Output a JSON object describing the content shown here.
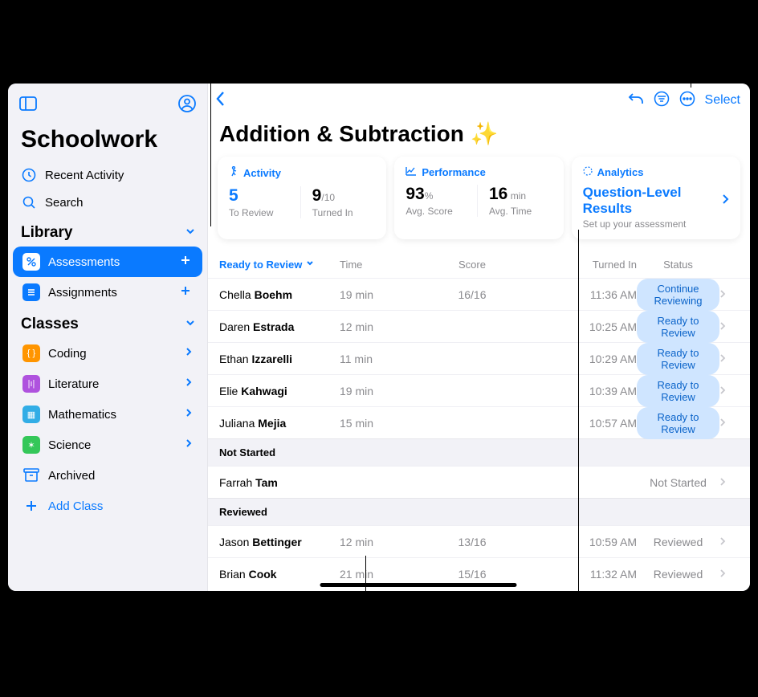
{
  "app": {
    "title": "Schoolwork"
  },
  "sidebar": {
    "recent_label": "Recent Activity",
    "search_label": "Search",
    "library_header": "Library",
    "lib_items": [
      {
        "label": "Assessments",
        "icon": "percent-icon",
        "color": "#0a7aff",
        "trailing": "plus",
        "active": true
      },
      {
        "label": "Assignments",
        "icon": "list-icon",
        "color": "#0a7aff",
        "trailing": "plus",
        "active": false
      }
    ],
    "classes_header": "Classes",
    "class_items": [
      {
        "label": "Coding",
        "color": "#ff9500"
      },
      {
        "label": "Literature",
        "color": "#af52de"
      },
      {
        "label": "Mathematics",
        "color": "#32ade6"
      },
      {
        "label": "Science",
        "color": "#34c759"
      }
    ],
    "archived_label": "Archived",
    "add_class_label": "Add Class"
  },
  "toolbar": {
    "select_label": "Select"
  },
  "page": {
    "title": "Addition & Subtraction ✨"
  },
  "cards": {
    "activity": {
      "head": "Activity",
      "m1_big": "5",
      "m1_sub": "To Review",
      "m2_big": "9",
      "m2_den": "/10",
      "m2_sub": "Turned In"
    },
    "performance": {
      "head": "Performance",
      "m1_big": "93",
      "m1_unit": "%",
      "m1_sub": "Avg. Score",
      "m2_big": "16",
      "m2_unit": " min",
      "m2_sub": "Avg. Time"
    },
    "analytics": {
      "head": "Analytics",
      "title": "Question-Level Results",
      "sub": "Set up your assessment"
    }
  },
  "table": {
    "cols": {
      "sort": "Ready to Review",
      "time": "Time",
      "score": "Score",
      "turned": "Turned In",
      "status": "Status"
    },
    "rows_review": [
      {
        "first": "Chella",
        "last": "Boehm",
        "time": "19 min",
        "score": "16/16",
        "turned": "11:36 AM",
        "status": "Continue Reviewing"
      },
      {
        "first": "Daren",
        "last": "Estrada",
        "time": "12 min",
        "score": "",
        "turned": "10:25 AM",
        "status": "Ready to Review"
      },
      {
        "first": "Ethan",
        "last": "Izzarelli",
        "time": "11 min",
        "score": "",
        "turned": "10:29 AM",
        "status": "Ready to Review"
      },
      {
        "first": "Elie",
        "last": "Kahwagi",
        "time": "19 min",
        "score": "",
        "turned": "10:39 AM",
        "status": "Ready to Review"
      },
      {
        "first": "Juliana",
        "last": "Mejia",
        "time": "15 min",
        "score": "",
        "turned": "10:57 AM",
        "status": "Ready to Review"
      }
    ],
    "section_notstarted": "Not Started",
    "rows_notstarted": [
      {
        "first": "Farrah",
        "last": "Tam",
        "status": "Not Started"
      }
    ],
    "section_reviewed": "Reviewed",
    "rows_reviewed": [
      {
        "first": "Jason",
        "last": "Bettinger",
        "time": "12 min",
        "score": "13/16",
        "turned": "10:59 AM",
        "status": "Reviewed"
      },
      {
        "first": "Brian",
        "last": "Cook",
        "time": "21 min",
        "score": "15/16",
        "turned": "11:32 AM",
        "status": "Reviewed"
      }
    ]
  }
}
